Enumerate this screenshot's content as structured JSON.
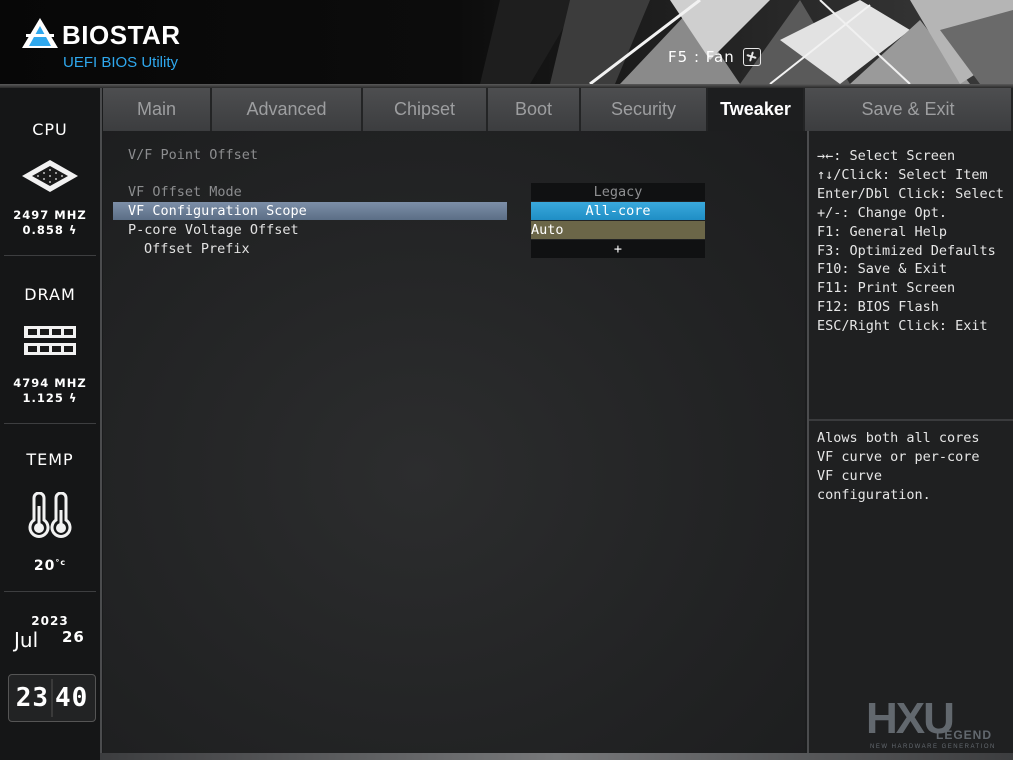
{
  "header": {
    "brand": "BIOSTAR",
    "subtitle": "UEFI BIOS Utility",
    "fan_hint": "F5 : Fan",
    "fan_icon": "fan-icon"
  },
  "side": {
    "cpu": {
      "title": "CPU",
      "freq": "2497 MHZ",
      "volt": "0.858",
      "icon": "cpu-chip-icon"
    },
    "dram": {
      "title": "DRAM",
      "freq": "4794 MHZ",
      "volt": "1.125",
      "icon": "memory-module-icon"
    },
    "temp": {
      "title": "TEMP",
      "value": "20",
      "icon": "thermometer-icon"
    },
    "date": {
      "year": "2023",
      "month": "Jul",
      "day": "26"
    },
    "clock": {
      "hh": "23",
      "mm": "40"
    }
  },
  "tabs": [
    {
      "label": "Main",
      "active": false
    },
    {
      "label": "Advanced",
      "active": false
    },
    {
      "label": "Chipset",
      "active": false
    },
    {
      "label": "Boot",
      "active": false
    },
    {
      "label": "Security",
      "active": false
    },
    {
      "label": "Tweaker",
      "active": true
    },
    {
      "label": "Save & Exit",
      "active": false
    }
  ],
  "main": {
    "section_title": "V/F Point Offset",
    "items": [
      {
        "label": "VF Offset Mode",
        "state": "dim"
      },
      {
        "label": "VF Configuration Scope",
        "state": "selected"
      },
      {
        "label": "P-core Voltage Offset",
        "state": "normal"
      },
      {
        "label": "Offset Prefix",
        "state": "normal"
      }
    ],
    "popup_options": [
      "Legacy",
      "All-core",
      "Auto",
      "+"
    ]
  },
  "help": {
    "keys": [
      "→←: Select Screen",
      "↑↓/Click: Select Item",
      "Enter/Dbl Click: Select",
      "+/-: Change Opt.",
      "F1: General Help",
      "F3: Optimized Defaults",
      "F10: Save & Exit",
      "F11: Print Screen",
      "F12: BIOS Flash",
      "ESC/Right Click: Exit"
    ],
    "description": [
      "Alows both all cores",
      "VF curve or per-core",
      "VF curve",
      "configuration."
    ]
  },
  "watermark": {
    "mark": "HXU",
    "word": "LEGEND",
    "tagline": "NEW HARDWARE GENERATION"
  },
  "colors": {
    "accent_blue": "#2fa8ee",
    "selected_option": "#1f8ec5",
    "current_value": "#6b6648",
    "selected_row": "#6a7d96"
  }
}
